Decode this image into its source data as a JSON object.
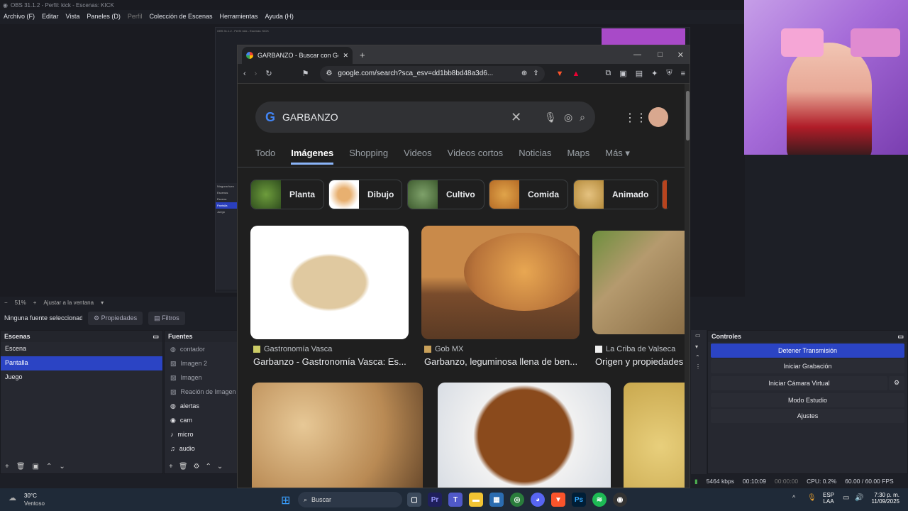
{
  "obs": {
    "title": "OBS 31.1.2 - Perfil: kick - Escenas: KICK",
    "menu": [
      "Archivo (F)",
      "Editar",
      "Vista",
      "Paneles (D)",
      "Perfil",
      "Colección de Escenas",
      "Herramientas",
      "Ayuda (H)"
    ],
    "zoom": "51%",
    "fit": "Ajustar a la ventana",
    "no_source": "Ninguna fuente seleccionada",
    "properties": "Propiedades",
    "filters": "Filtros",
    "scenes_title": "Escenas",
    "scenes": [
      "Escena",
      "Pantalla",
      "Juego"
    ],
    "sources_title": "Fuentes",
    "sources": [
      "contador",
      "Imagen 2",
      "Imagen",
      "Reación de Imagen",
      "alertas",
      "cam",
      "micro",
      "audio"
    ],
    "controls_title": "Controles",
    "controls": [
      "Detener Transmisión",
      "Iniciar Grabación",
      "Iniciar Cámara Virtual",
      "Modo Estudio",
      "Ajustes"
    ],
    "status": {
      "kbps": "5464 kbps",
      "live_time": "00:10:09",
      "rec_time": "00:00:00",
      "cpu": "CPU: 0.2%",
      "fps": "60.00 / 60.00 FPS"
    }
  },
  "nested": {
    "scenes": [
      "Escenas",
      "Escena",
      "Pantalla",
      "Juego"
    ],
    "no_source": "Ninguna fuen"
  },
  "chrome": {
    "tab_title": "GARBANZO - Buscar con Google",
    "url": "google.com/search?sca_esv=dd1bb8bd48a3d6...",
    "search_query": "GARBANZO",
    "tabs": [
      "Todo",
      "Imágenes",
      "Shopping",
      "Videos",
      "Videos cortos",
      "Noticias",
      "Maps",
      "Más"
    ],
    "pills": [
      "Planta",
      "Dibujo",
      "Cultivo",
      "Comida",
      "Animado"
    ],
    "results": [
      {
        "source": "Gastronomía Vasca",
        "title": "Garbanzo - Gastronomía Vasca: Es..."
      },
      {
        "source": "Gob MX",
        "title": "Garbanzo, leguminosa llena de ben..."
      },
      {
        "source": "La Criba de Valseca",
        "title": "Origen y propiedades"
      }
    ]
  },
  "taskbar": {
    "weather_temp": "30°C",
    "weather_desc": "Ventoso",
    "search": "Buscar",
    "lang": "ESP",
    "region": "LAA",
    "time": "7:30 p. m.",
    "date": "11/09/2025"
  },
  "colors": {
    "accent": "#2b44c4",
    "link": "#8ab4f8"
  }
}
